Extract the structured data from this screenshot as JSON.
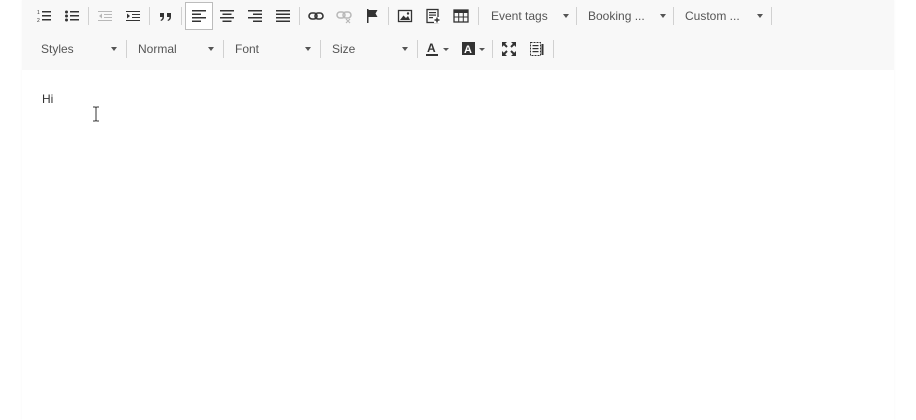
{
  "toolbar": {
    "event_tags_label": "Event tags",
    "booking_label": "Booking ...",
    "custom_label": "Custom ...",
    "styles_label": "Styles",
    "format_label": "Normal",
    "font_label": "Font",
    "size_label": "Size"
  },
  "icons": {
    "numbered_list": "numbered-list-icon",
    "bulleted_list": "bulleted-list-icon",
    "outdent": "outdent-icon",
    "indent": "indent-icon",
    "blockquote": "blockquote-icon",
    "align_left": "align-left-icon",
    "align_center": "align-center-icon",
    "align_right": "align-right-icon",
    "justify": "justify-icon",
    "link": "link-icon",
    "unlink": "unlink-icon",
    "anchor": "flag-icon",
    "image": "image-icon",
    "embed": "embed-icon",
    "table": "table-icon",
    "text_color": "text-color-icon",
    "background_color": "background-color-icon",
    "maximize": "maximize-icon",
    "show_blocks": "show-blocks-icon"
  },
  "colors": {
    "toolbar_bg": "#f8f8f8",
    "separator": "#d1d1d1",
    "icon": "#333333",
    "disabled_icon": "#b8b8b8"
  },
  "editor": {
    "text": "Hi"
  }
}
